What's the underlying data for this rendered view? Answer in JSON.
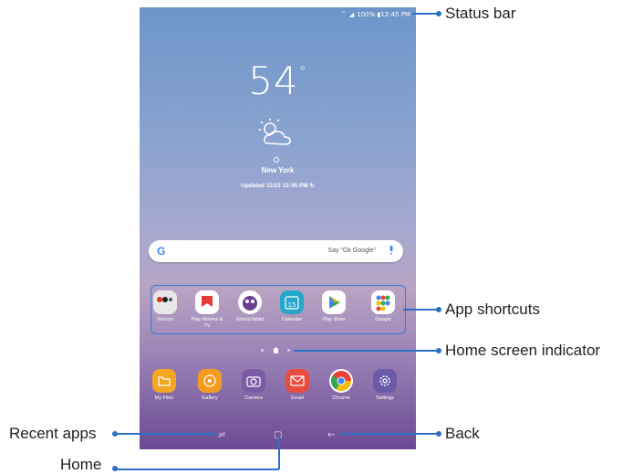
{
  "status_bar": {
    "text": "100% ▮12:45 PM"
  },
  "weather": {
    "temperature": "54",
    "degree": "°",
    "city": "New York",
    "updated": "Updated 11/15 12:45 PM"
  },
  "search": {
    "hint": "Say \"Ok Google\""
  },
  "shortcuts": [
    {
      "label": "Verizon",
      "color": "#e8e8e8"
    },
    {
      "label": "Play Movies & TV",
      "color": "#ffffff"
    },
    {
      "label": "GizmoTablet",
      "color": "#ffffff"
    },
    {
      "label": "Calendar",
      "color": "#26a6c9"
    },
    {
      "label": "Play Store",
      "color": "#ffffff"
    },
    {
      "label": "Google",
      "color": "#ffffff"
    }
  ],
  "dock": [
    {
      "label": "My Files",
      "color": "#f5a623"
    },
    {
      "label": "Gallery",
      "color": "#f39c1f"
    },
    {
      "label": "Camera",
      "color": "#7b5ba6"
    },
    {
      "label": "Email",
      "color": "#e84c3d"
    },
    {
      "label": "Chrome",
      "color": "#ffffff"
    },
    {
      "label": "Settings",
      "color": "#6a5aa8"
    }
  ],
  "callouts": {
    "status_bar": "Status bar",
    "app_shortcuts": "App shortcuts",
    "home_screen_indicator": "Home screen indicator",
    "back": "Back",
    "recent_apps": "Recent apps",
    "home": "Home"
  },
  "accent_color": "#2d6fc4"
}
